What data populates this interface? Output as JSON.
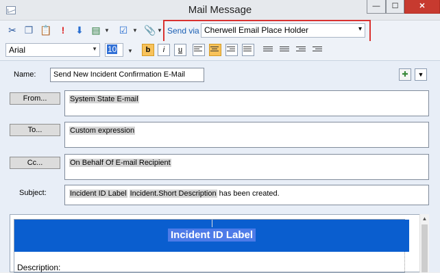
{
  "window": {
    "title": "Mail Message",
    "min_glyph": "—",
    "max_glyph": "☐",
    "close_glyph": "✕"
  },
  "toolbar": {
    "icons": [
      "cut-icon",
      "copy-icon",
      "paste-icon",
      "priority-icon",
      "low-priority-icon",
      "form-icon",
      "checklist-icon",
      "attachment-icon"
    ],
    "send_via_label": "Send via",
    "send_via_value": "Cherwell Email Place Holder"
  },
  "format_bar": {
    "font": "Arial",
    "size": "10",
    "bold": "b",
    "italic": "i",
    "underline": "u"
  },
  "form": {
    "name_label": "Name:",
    "name_value": "Send New Incident Confirmation E-Mail",
    "from_button": "From...",
    "from_value": "System State E-mail",
    "to_button": "To...",
    "to_value": "Custom expression",
    "cc_button": "Cc...",
    "cc_value": "On Behalf Of E-mail Recipient",
    "subject_label": "Subject:",
    "subject_part1": "Incident ID Label",
    "subject_part2": "Incident.Short Description",
    "subject_part3": " has been created."
  },
  "body": {
    "header": "Incident ID Label",
    "description_label": "Description:"
  },
  "colors": {
    "accent": "#0a5ecf",
    "highlight_border": "#d9312f",
    "active_button": "#f8c25a"
  }
}
